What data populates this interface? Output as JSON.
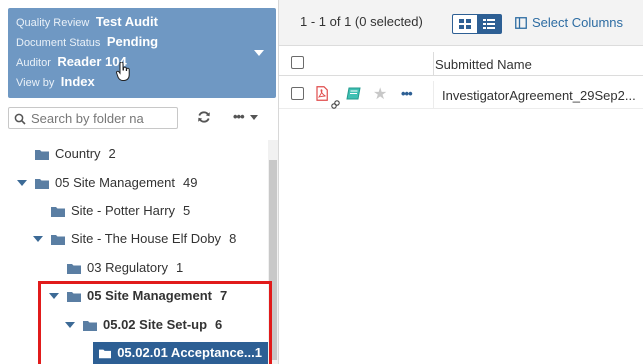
{
  "info_panel": {
    "quality_review_label": "Quality Review",
    "quality_review_value": "Test Audit",
    "document_status_label": "Document Status",
    "document_status_value": "Pending",
    "auditor_label": "Auditor",
    "auditor_value": "Reader 104",
    "view_by_label": "View by",
    "view_by_value": "Index"
  },
  "search": {
    "placeholder": "Search by folder na"
  },
  "tree": [
    {
      "label": "Country",
      "count": "2"
    },
    {
      "label": "05 Site Management",
      "count": "49"
    },
    {
      "label": "Site - Potter Harry",
      "count": "5"
    },
    {
      "label": "Site - The House Elf Doby",
      "count": "8"
    },
    {
      "label": "03 Regulatory",
      "count": "1"
    },
    {
      "label": "05 Site Management",
      "count": "7"
    },
    {
      "label": "05.02 Site Set-up",
      "count": "6"
    },
    {
      "label": "05.02.01 Acceptance...",
      "count": "1"
    }
  ],
  "toolbar": {
    "status": "1 - 1 of 1 (0 selected)",
    "select_columns": "Select Columns"
  },
  "grid": {
    "columns": [
      "Submitted Name"
    ],
    "rows": [
      {
        "submitted_name": "InvestigatorAgreement_29Sep2..."
      }
    ]
  },
  "colors": {
    "info_bg": "#6f98c3",
    "selected_bg": "#2d5f94",
    "highlight_border": "#e11b1b",
    "folder": "#5a7ea3",
    "link": "#2d6ca2"
  }
}
